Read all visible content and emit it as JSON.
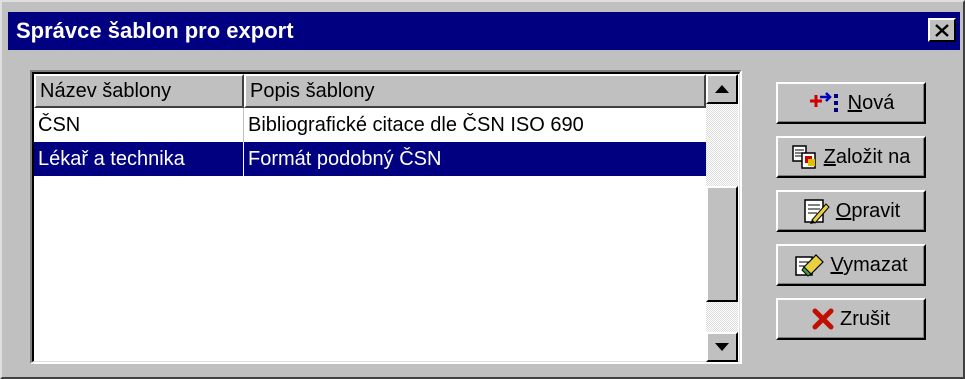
{
  "window": {
    "title": "Správce šablon pro export",
    "close_glyph": "×"
  },
  "list": {
    "columns": [
      "Název šablony",
      "Popis šablony"
    ],
    "rows": [
      {
        "name": "ČSN",
        "description": "Bibliografické citace dle ČSN ISO 690",
        "selected": false
      },
      {
        "name": "Lékař a technika",
        "description": "Formát podobný ČSN",
        "selected": true
      }
    ]
  },
  "buttons": [
    {
      "id": "nova",
      "label": "Nová",
      "mnemonic": "N",
      "icon": "new-icon"
    },
    {
      "id": "zalozit",
      "label": "Založit na",
      "mnemonic": "Z",
      "icon": "copy-icon"
    },
    {
      "id": "opravit",
      "label": "Opravit",
      "mnemonic": "O",
      "icon": "edit-icon"
    },
    {
      "id": "vymazat",
      "label": "Vymazat",
      "mnemonic": "V",
      "icon": "eraser-icon"
    },
    {
      "id": "zrusit",
      "label": "Zrušit",
      "mnemonic": "",
      "icon": "cancel-icon"
    }
  ],
  "colors": {
    "title_bar": "#000080",
    "selection": "#000080",
    "face": "#c0c0c0"
  }
}
